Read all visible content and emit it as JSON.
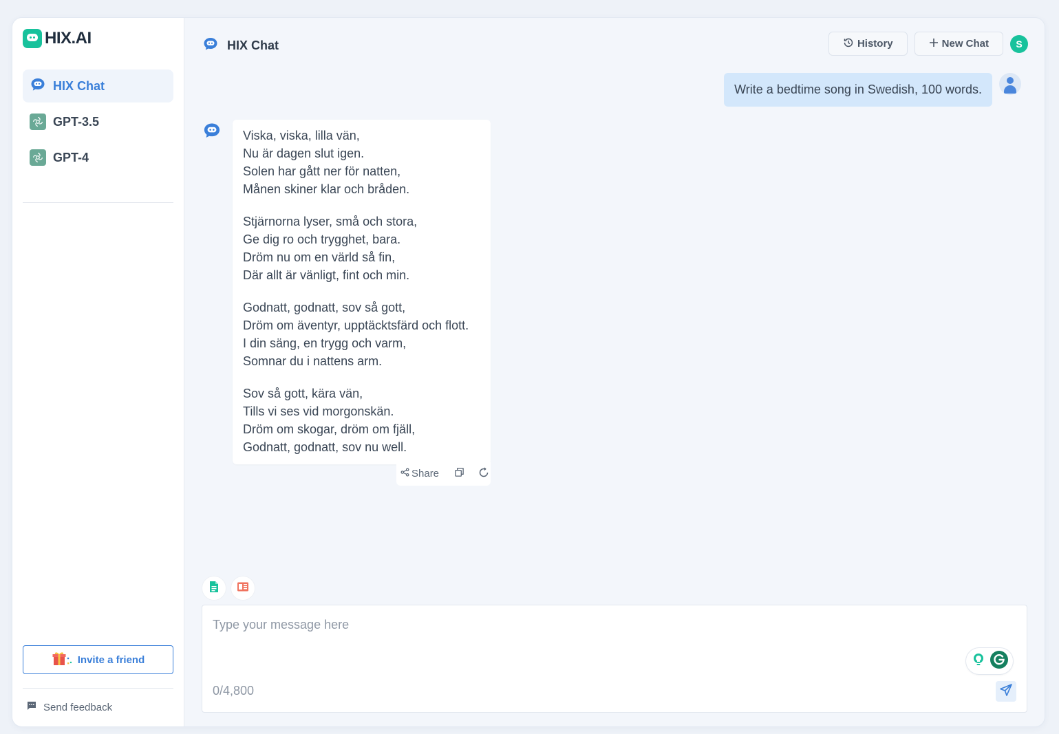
{
  "brand": {
    "name": "HIX.AI"
  },
  "sidebar": {
    "items": [
      {
        "label": "HIX Chat",
        "icon": "chat-bubble-icon",
        "active": true
      },
      {
        "label": "GPT-3.5",
        "icon": "openai-icon",
        "active": false
      },
      {
        "label": "GPT-4",
        "icon": "openai-icon",
        "active": false
      }
    ],
    "invite_label": "Invite a friend",
    "feedback_label": "Send feedback"
  },
  "header": {
    "title": "HIX Chat",
    "history_label": "History",
    "new_chat_label": "New Chat",
    "avatar_initial": "S"
  },
  "conversation": {
    "user_message": "Write a bedtime song in Swedish, 100 words.",
    "bot_stanzas": [
      [
        "Viska, viska, lilla vän,",
        "Nu är dagen slut igen.",
        "Solen har gått ner för natten,",
        "Månen skiner klar och bråden."
      ],
      [
        "Stjärnorna lyser, små och stora,",
        "Ge dig ro och trygghet, bara.",
        "Dröm nu om en värld så fin,",
        "Där allt är vänligt, fint och min."
      ],
      [
        "Godnatt, godnatt, sov så gott,",
        "Dröm om äventyr, upptäcktsfärd och flott.",
        "I din säng, en trygg och varm,",
        "Somnar du i nattens arm."
      ],
      [
        "Sov så gott, kära vän,",
        "Tills vi ses vid morgonskän.",
        "Dröm om skogar, dröm om fjäll,",
        "Godnatt, godnatt, sov nu well."
      ]
    ],
    "share_label": "Share"
  },
  "composer": {
    "placeholder": "Type your message here",
    "value": "",
    "counter": "0/4,800"
  },
  "colors": {
    "accent": "#3a7fd9",
    "brand_green": "#18c29c",
    "user_bubble": "#d3e7fb"
  }
}
